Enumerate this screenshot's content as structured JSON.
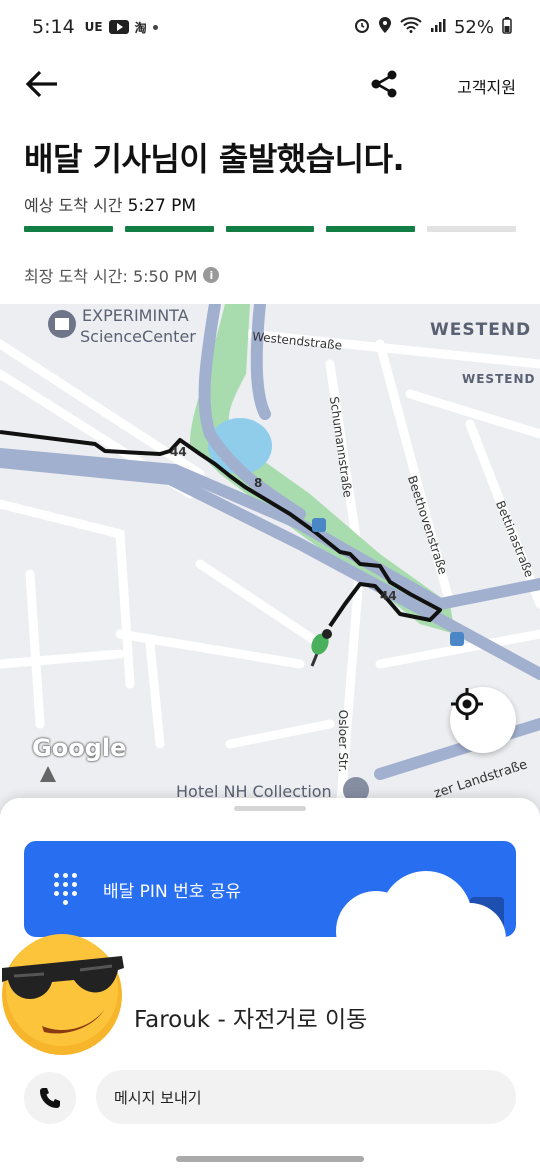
{
  "status_bar": {
    "time": "5:14",
    "left_icons": [
      "UE",
      "youtube-icon",
      "淘"
    ],
    "battery": "52%"
  },
  "app_bar": {
    "support_label": "고객지원"
  },
  "order": {
    "title": "배달 기사님이 출발했습니다.",
    "eta_label": "예상 도착 시간",
    "eta_value": "5:27 PM",
    "latest_label": "최장 도착 시간: 5:50 PM",
    "progress": {
      "completed_segments": 4,
      "total_segments": 5
    },
    "colors": {
      "progress_done": "#137e43",
      "progress_pending": "#e2e2e2"
    }
  },
  "map": {
    "labels": {
      "museum": "EXPERIMINTA",
      "museum_2": "ScienceCenter",
      "westendstrasse": "Westendstraße",
      "westend_big": "WESTEND",
      "westend_small": "WESTEND",
      "schumannstrasse": "Schumannstraße",
      "beethovenstrasse": "Beethovenstraße",
      "bettinastrasse": "Bettinastraße",
      "oslerstr": "Osloer Str.",
      "hotel": "Hotel NH Collection",
      "landstrasse": "zer Landstraße",
      "road_44a": "44",
      "road_8": "8",
      "road_44b": "44"
    },
    "attribution": "Google"
  },
  "sheet": {
    "pin_button_label": "배달 PIN 번호 공유",
    "driver_text": "Farouk - 자전거로 이동",
    "message_placeholder": "메시지 보내기",
    "colors": {
      "accent": "#276ef1"
    }
  }
}
